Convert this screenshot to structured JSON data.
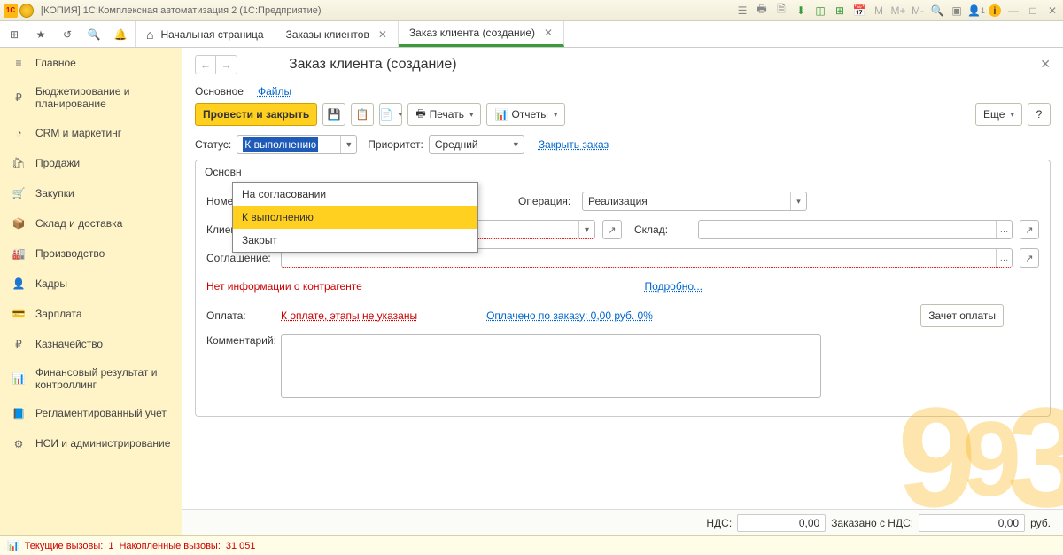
{
  "titlebar": {
    "text": "[КОПИЯ] 1С:Комплексная автоматизация 2 (1С:Предприятие)",
    "memlabels": {
      "m": "M",
      "mplus": "M+",
      "mminus": "M-"
    },
    "usercount": "1"
  },
  "tabs": {
    "home": "Начальная страница",
    "t1": "Заказы клиентов",
    "t2": "Заказ клиента (создание)"
  },
  "sidebar": {
    "items": [
      {
        "label": "Главное",
        "icon": "≡"
      },
      {
        "label": "Бюджетирование и планирование",
        "icon": "₽"
      },
      {
        "label": "CRM и маркетинг",
        "icon": "◔"
      },
      {
        "label": "Продажи",
        "icon": "🛍"
      },
      {
        "label": "Закупки",
        "icon": "🛒"
      },
      {
        "label": "Склад и доставка",
        "icon": "📦"
      },
      {
        "label": "Производство",
        "icon": "🏭"
      },
      {
        "label": "Кадры",
        "icon": "👤"
      },
      {
        "label": "Зарплата",
        "icon": "💳"
      },
      {
        "label": "Казначейство",
        "icon": "₽"
      },
      {
        "label": "Финансовый результат и контроллинг",
        "icon": "📊"
      },
      {
        "label": "Регламентированный учет",
        "icon": "📘"
      },
      {
        "label": "НСИ и администрирование",
        "icon": "⚙"
      }
    ]
  },
  "page": {
    "title": "Заказ клиента (создание)",
    "subtabs": {
      "main": "Основное",
      "files": "Файлы"
    }
  },
  "toolbar": {
    "post_close": "Провести и закрыть",
    "print": "Печать",
    "reports": "Отчеты",
    "more": "Еще",
    "help": "?"
  },
  "form": {
    "status_label": "Статус:",
    "status_value": "К выполнению",
    "priority_label": "Приоритет:",
    "priority_value": "Средний",
    "close_order": "Закрыть заказ",
    "status_options": [
      "На согласовании",
      "К выполнению",
      "Закрыт"
    ]
  },
  "tabctrl": {
    "tab": "Основн",
    "number_label": "Номер:",
    "client_label": "Клиент:",
    "agreement_label": "Соглашение:",
    "operation_label": "Операция:",
    "operation_value": "Реализация",
    "warehouse_label": "Склад:",
    "warn": "Нет информации о контрагенте",
    "more": "Подробно...",
    "payment_label": "Оплата:",
    "payment_link": "К оплате, этапы не указаны",
    "paid_link": "Оплачено по заказу: 0,00 руб.   0%",
    "offset_btn": "Зачет оплаты",
    "comment_label": "Комментарий:"
  },
  "totals": {
    "vat_label": "НДС:",
    "vat_value": "0,00",
    "ordered_label": "Заказано с НДС:",
    "ordered_value": "0,00",
    "currency": "руб."
  },
  "statusbar": {
    "current_label": "Текущие вызовы:",
    "current_value": "1",
    "accum_label": "Накопленные вызовы:",
    "accum_value": "31 051"
  }
}
